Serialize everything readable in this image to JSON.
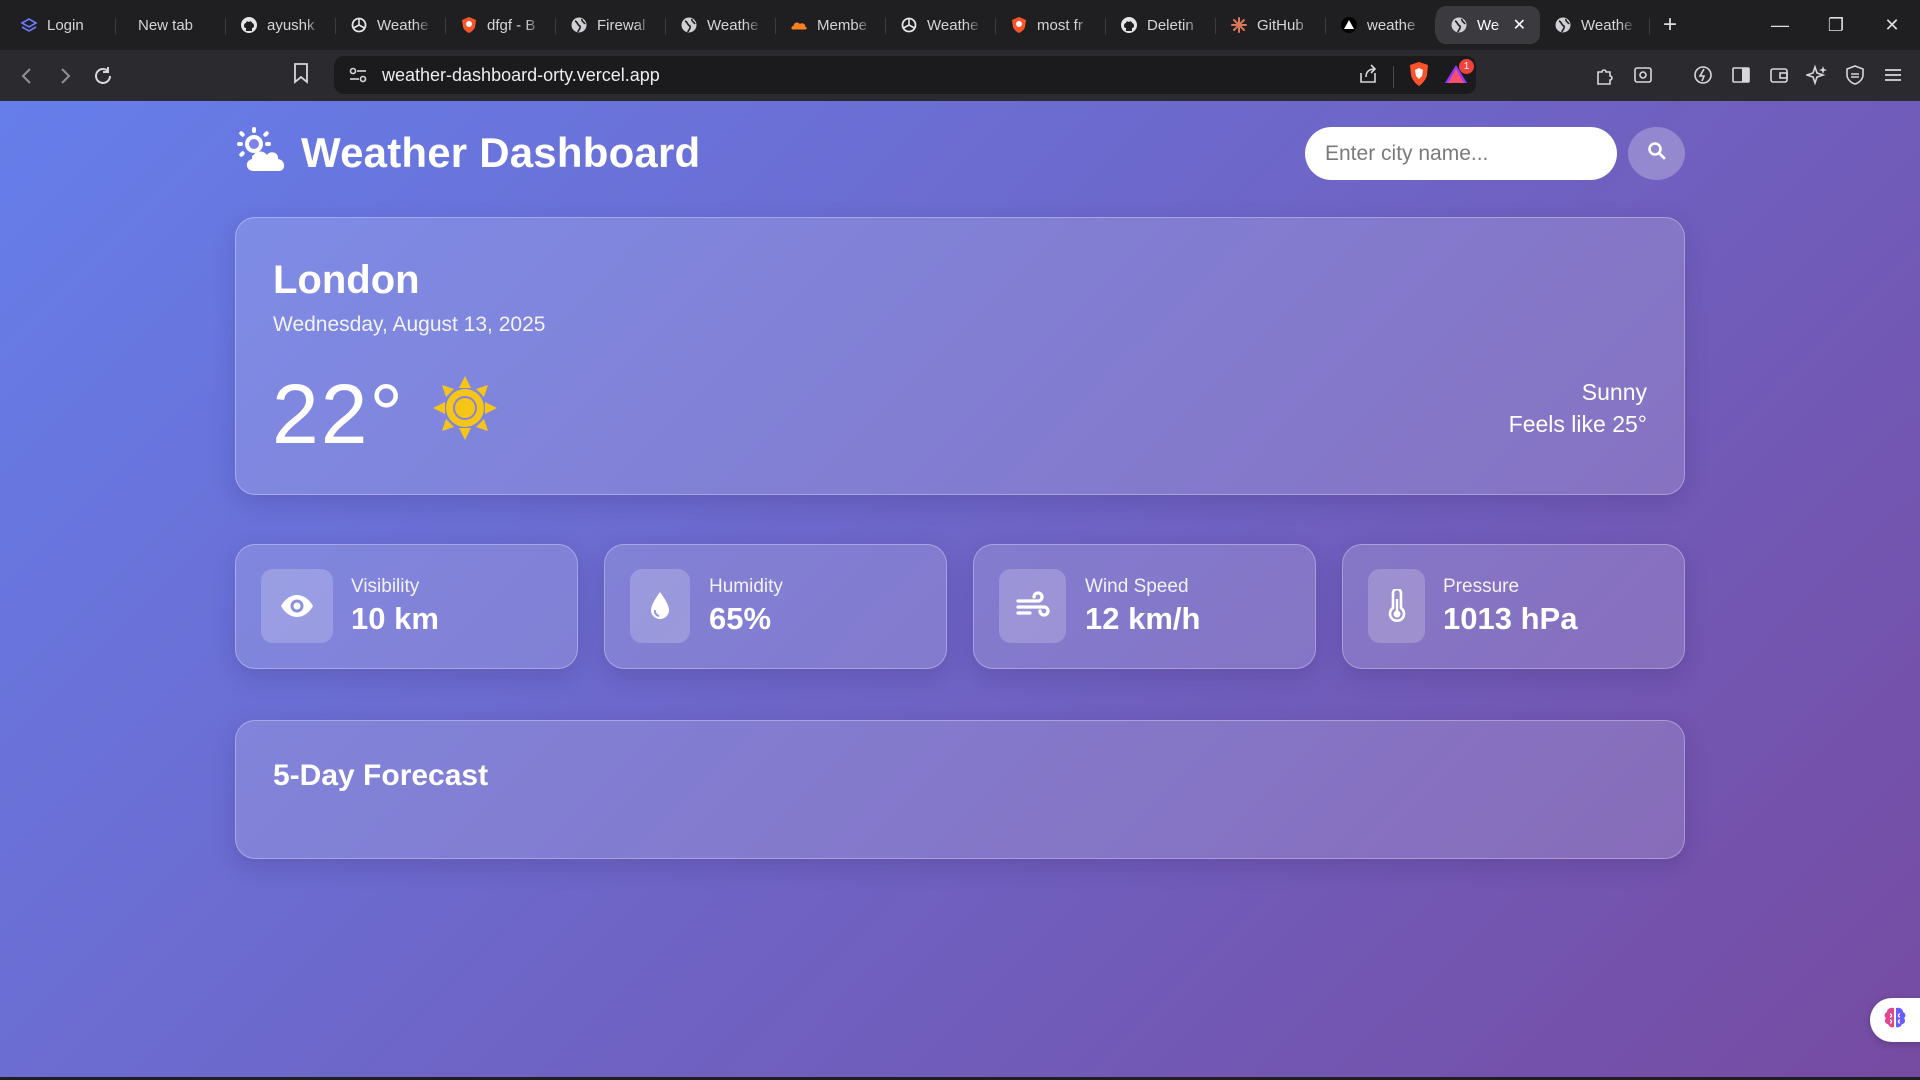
{
  "browser": {
    "tabs": [
      {
        "title": "Login",
        "icon": "layers-icon",
        "color": "#6b7cff"
      },
      {
        "title": "New tab",
        "icon": "none"
      },
      {
        "title": "ayushk",
        "icon": "github-icon"
      },
      {
        "title": "Weathe",
        "icon": "openai-icon"
      },
      {
        "title": "dfgf - B",
        "icon": "brave-shield-icon"
      },
      {
        "title": "Firewal",
        "icon": "globe-icon"
      },
      {
        "title": "Weathe",
        "icon": "globe-icon"
      },
      {
        "title": "Membe",
        "icon": "cloudflare-icon",
        "color": "#f48120"
      },
      {
        "title": "Weathe",
        "icon": "openai-icon"
      },
      {
        "title": "most fr",
        "icon": "brave-shield-icon"
      },
      {
        "title": "Deletin",
        "icon": "github-icon"
      },
      {
        "title": "GitHub",
        "icon": "claude-icon",
        "color": "#d97757"
      },
      {
        "title": "weathe",
        "icon": "vercel-icon"
      },
      {
        "title": "We",
        "icon": "globe-icon",
        "active": true
      },
      {
        "title": "Weathe",
        "icon": "globe-icon"
      }
    ],
    "url": "weather-dashboard-orty.vercel.app",
    "rewards_badge": "1"
  },
  "app": {
    "title": "Weather Dashboard",
    "search_placeholder": "Enter city name...",
    "accent_gradient": [
      "#667eea",
      "#764ba2"
    ]
  },
  "current": {
    "city": "London",
    "date": "Wednesday, August 13, 2025",
    "temperature": "22°",
    "condition": "Sunny",
    "feels_like": "Feels like 25°",
    "icon": "sun-icon",
    "icon_color": "#f5c518"
  },
  "stats": [
    {
      "label": "Visibility",
      "value": "10 km",
      "icon": "eye-icon"
    },
    {
      "label": "Humidity",
      "value": "65%",
      "icon": "droplet-icon"
    },
    {
      "label": "Wind Speed",
      "value": "12 km/h",
      "icon": "wind-icon"
    },
    {
      "label": "Pressure",
      "value": "1013 hPa",
      "icon": "thermometer-icon"
    }
  ],
  "forecast": {
    "title": "5-Day Forecast"
  }
}
